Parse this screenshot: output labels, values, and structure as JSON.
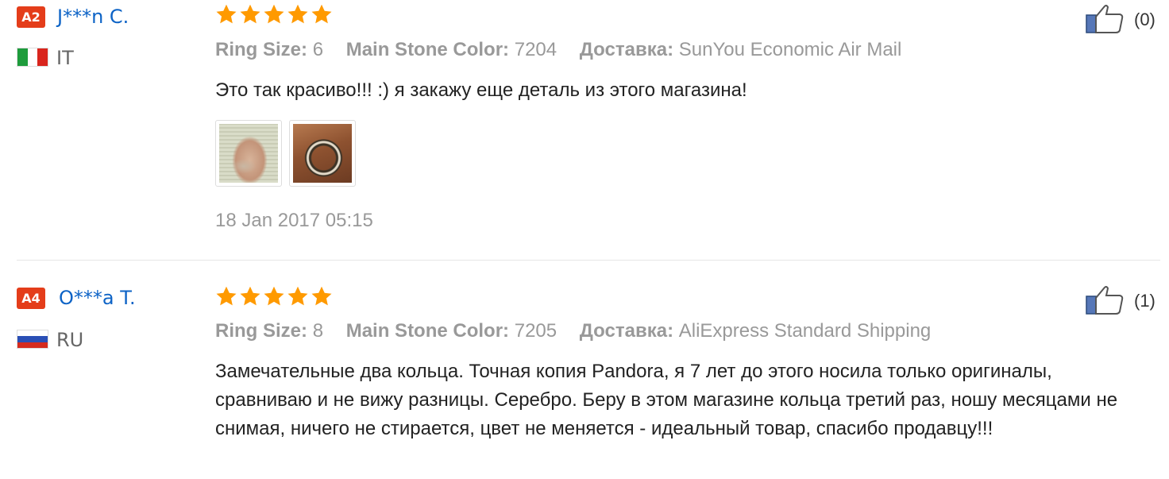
{
  "reviews": [
    {
      "level": "A2",
      "user": "J***n C.",
      "country": "IT",
      "rating": 5,
      "attributes": [
        {
          "key": "Ring Size:",
          "value": "6"
        },
        {
          "key": "Main Stone Color:",
          "value": "7204"
        },
        {
          "key": "Доставка:",
          "value": "SunYou Economic Air Mail"
        }
      ],
      "text": "Это так красиво!!! :) я закажу еще деталь из этого магазина!",
      "date": "18 Jan 2017 05:15",
      "likes": "(0)"
    },
    {
      "level": "A4",
      "user": "O***a T.",
      "country": "RU",
      "rating": 5,
      "attributes": [
        {
          "key": "Ring Size:",
          "value": "8"
        },
        {
          "key": "Main Stone Color:",
          "value": "7205"
        },
        {
          "key": "Доставка:",
          "value": "AliExpress Standard Shipping"
        }
      ],
      "text": "Замечательные два кольца. Точная копия Pandora, я 7 лет до этого носила только оригиналы, сравниваю и не вижу разницы. Серебро. Беру в этом магазине кольца третий раз, ношу месяцами не снимая, ничего не стирается, цвет не меняется - идеальный товар, спасибо продавцу!!!",
      "likes": "(1)"
    }
  ],
  "colors": {
    "badge": "#e43d1a",
    "username": "#0d63c6",
    "star": "#ff9a00",
    "muted": "#999999",
    "like_icon": "#5677b8"
  },
  "icons": [
    "star-icon",
    "thumbs-up-icon",
    "flag-it-icon",
    "flag-ru-icon"
  ]
}
